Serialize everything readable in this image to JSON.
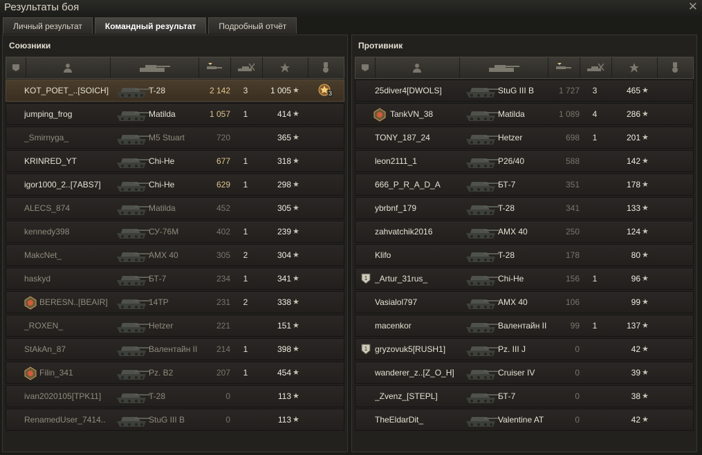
{
  "window": {
    "title": "Результаты боя"
  },
  "tabs": [
    "Личный результат",
    "Командный результат",
    "Подробный отчёт"
  ],
  "allies": {
    "title": "Союзники",
    "rows": [
      {
        "player": "KOT_POET_..[SOICH]",
        "tank": "T-28",
        "damage": "2 142",
        "kills": "3",
        "score": "1 005",
        "highlight": "self",
        "medal": "3"
      },
      {
        "player": "jumping_frog",
        "tank": "Matilda",
        "damage": "1 057",
        "kills": "1",
        "score": "414",
        "highlight": "bright"
      },
      {
        "player": "_Smirnyga_",
        "tank": "M5 Stuart",
        "damage": "720",
        "kills": "",
        "score": "365",
        "highlight": "dim",
        "dmg_low": true
      },
      {
        "player": "KRINRED_YT",
        "tank": "Chi-He",
        "damage": "677",
        "kills": "1",
        "score": "318",
        "highlight": "bright"
      },
      {
        "player": "igor1000_2..[7ABS7]",
        "tank": "Chi-He",
        "damage": "629",
        "kills": "1",
        "score": "298",
        "highlight": "bright"
      },
      {
        "player": "ALECS_874",
        "tank": "Matilda",
        "damage": "452",
        "kills": "",
        "score": "305",
        "highlight": "dim",
        "dmg_low": true
      },
      {
        "player": "kennedy398",
        "tank": "СУ-76М",
        "damage": "402",
        "kills": "1",
        "score": "239",
        "highlight": "dim",
        "dmg_low": true
      },
      {
        "player": "MakcNet_",
        "tank": "AMX 40",
        "damage": "305",
        "kills": "2",
        "score": "304",
        "highlight": "dim",
        "dmg_low": true
      },
      {
        "player": "haskyd",
        "tank": "БТ-7",
        "damage": "234",
        "kills": "1",
        "score": "341",
        "highlight": "dim",
        "dmg_low": true
      },
      {
        "player": "BERESN..[BEAIR]",
        "tank": "14TP",
        "damage": "231",
        "kills": "2",
        "score": "338",
        "highlight": "dim",
        "dmg_low": true,
        "clan_icon": true
      },
      {
        "player": "_ROXEN_",
        "tank": "Hetzer",
        "damage": "221",
        "kills": "",
        "score": "151",
        "highlight": "dim",
        "dmg_low": true
      },
      {
        "player": "StAkAn_87",
        "tank": "Валентайн II",
        "damage": "214",
        "kills": "1",
        "score": "398",
        "highlight": "dim",
        "dmg_low": true
      },
      {
        "player": "Filin_341",
        "tank": "Pz. B2",
        "damage": "207",
        "kills": "1",
        "score": "454",
        "highlight": "dim",
        "dmg_low": true,
        "clan_icon": true
      },
      {
        "player": "ivan2020105[TPK11]",
        "tank": "T-28",
        "damage": "0",
        "kills": "",
        "score": "113",
        "highlight": "dim",
        "dmg_low": true
      },
      {
        "player": "RenamedUser_7414..",
        "tank": "StuG III B",
        "damage": "0",
        "kills": "",
        "score": "113",
        "highlight": "dim",
        "dmg_low": true
      }
    ]
  },
  "enemies": {
    "title": "Противник",
    "rows": [
      {
        "player": "25diver4[DWOLS]",
        "tank": "StuG III B",
        "damage": "1 727",
        "kills": "3",
        "score": "465"
      },
      {
        "player": "TankVN_38",
        "tank": "Matilda",
        "damage": "1 089",
        "kills": "4",
        "score": "286",
        "clan_icon": true
      },
      {
        "player": "TONY_187_24",
        "tank": "Hetzer",
        "damage": "698",
        "kills": "1",
        "score": "201"
      },
      {
        "player": "leon2111_1",
        "tank": "P26/40",
        "damage": "588",
        "kills": "",
        "score": "142"
      },
      {
        "player": "666_P_R_A_D_A",
        "tank": "БТ-7",
        "damage": "351",
        "kills": "",
        "score": "178"
      },
      {
        "player": "ybrbnf_179",
        "tank": "T-28",
        "damage": "341",
        "kills": "",
        "score": "133"
      },
      {
        "player": "zahvatchik2016",
        "tank": "AMX 40",
        "damage": "250",
        "kills": "",
        "score": "124"
      },
      {
        "player": "Klifo",
        "tank": "T-28",
        "damage": "178",
        "kills": "",
        "score": "80"
      },
      {
        "player": "_Artur_31rus_",
        "tank": "Chi-He",
        "damage": "156",
        "kills": "1",
        "score": "96",
        "badge": "1"
      },
      {
        "player": "Vasialol797",
        "tank": "AMX 40",
        "damage": "106",
        "kills": "",
        "score": "99"
      },
      {
        "player": "macenkor",
        "tank": "Валентайн II",
        "damage": "99",
        "kills": "1",
        "score": "137"
      },
      {
        "player": "gryzovuk5[RUSH1]",
        "tank": "Pz. III J",
        "damage": "0",
        "kills": "",
        "score": "42",
        "badge": "1"
      },
      {
        "player": "wanderer_z..[Z_O_H]",
        "tank": "Cruiser IV",
        "damage": "0",
        "kills": "",
        "score": "39"
      },
      {
        "player": "_Zvenz_[STEPL]",
        "tank": "БТ-7",
        "damage": "0",
        "kills": "",
        "score": "38"
      },
      {
        "player": "TheEldarDit_",
        "tank": "Valentine AT",
        "damage": "0",
        "kills": "",
        "score": "42"
      }
    ]
  },
  "star_glyph": "★",
  "close_glyph": "✕",
  "colors": {
    "accent_damage": "#e0c58a",
    "self_row": "#4a3d2c"
  }
}
